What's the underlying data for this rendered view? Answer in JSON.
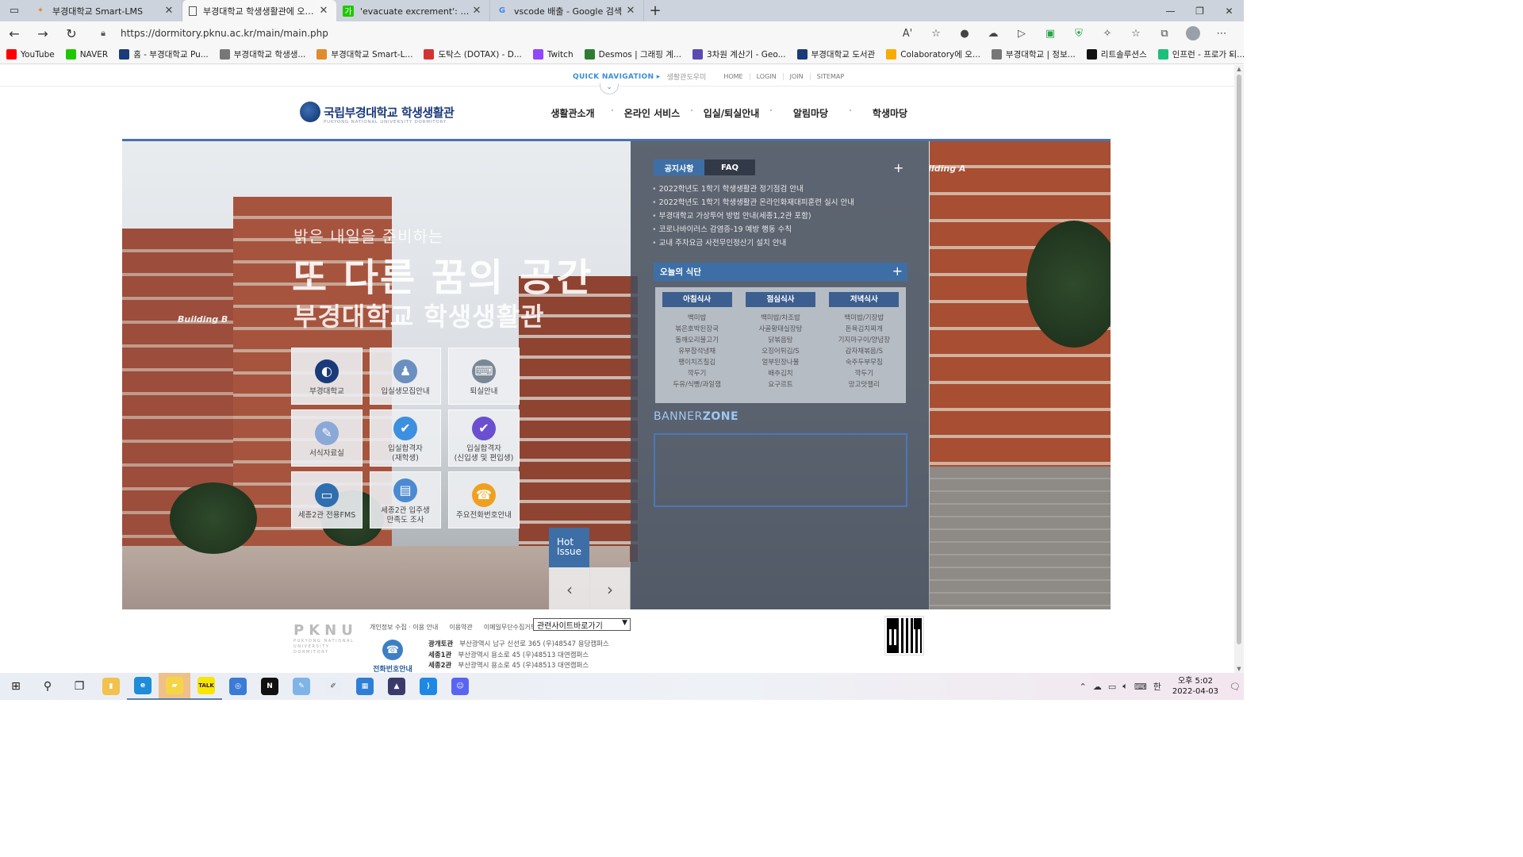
{
  "browser": {
    "tabs": [
      {
        "title": "부경대학교 Smart-LMS",
        "active": false,
        "favicon": "lms-icon",
        "color": "#e08b2c"
      },
      {
        "title": "부경대학교 학생생활관에 오신 것을",
        "active": true,
        "favicon": "page-icon",
        "color": "#555555"
      },
      {
        "title": "'evacuate excrement': 네이버 영어",
        "active": false,
        "favicon": "papago-icon",
        "color": "#1ec800"
      },
      {
        "title": "vscode 배출 - Google 검색",
        "active": false,
        "favicon": "google-icon",
        "color": "#4285f4"
      }
    ],
    "url": "https://dormitory.pknu.ac.kr/main/main.php",
    "bookmarks": [
      {
        "label": "YouTube",
        "color": "#ff0000"
      },
      {
        "label": "NAVER",
        "color": "#1ec800"
      },
      {
        "label": "홈 - 부경대학교 Pu...",
        "color": "#1b3a7a"
      },
      {
        "label": "부경대학교 학생생...",
        "color": "#777777"
      },
      {
        "label": "부경대학교 Smart-L...",
        "color": "#e08b2c"
      },
      {
        "label": "도탁스 (DOTAX) - D...",
        "color": "#d33333"
      },
      {
        "label": "Twitch",
        "color": "#9146ff"
      },
      {
        "label": "Desmos | 그래핑 계...",
        "color": "#2f7d32"
      },
      {
        "label": "3차원 계산기 - Geo...",
        "color": "#5a4ab2"
      },
      {
        "label": "부경대학교 도서관",
        "color": "#1b3a7a"
      },
      {
        "label": "Colaboratory에 오...",
        "color": "#f9ab00"
      },
      {
        "label": "부경대학교 | 정보...",
        "color": "#777777"
      },
      {
        "label": "리트솔루션스",
        "color": "#111111"
      },
      {
        "label": "인프런 - 프로가 되...",
        "color": "#1dc078"
      }
    ]
  },
  "site": {
    "quick_nav": "QUICK NAVIGATION",
    "quick_nav_sub": "생활관도우미",
    "top_links": [
      "HOME",
      "LOGIN",
      "JOIN",
      "SITEMAP"
    ],
    "logo_kr": "국립부경대학교 학생생활관",
    "logo_en": "PUKYONG NATIONAL UNIVERSITY DORMITORY",
    "gnb": [
      "생활관소개",
      "온라인 서비스",
      "입실/퇴실안내",
      "알림마당",
      "학생마당"
    ],
    "slogan": {
      "line1": "밝은 내일을 준비하는",
      "line2": "또 다른 꿈의 공간",
      "line3": "부경대학교 학생생활관"
    },
    "building_labels": [
      "Building B",
      "Building A"
    ],
    "quick_links": [
      {
        "label": "부경대학교",
        "icon": "pknu-logo-icon",
        "color": "#1b3a7a"
      },
      {
        "label": "입실생모집안내",
        "icon": "person-icon",
        "color": "#6a8fc0"
      },
      {
        "label": "퇴실안내",
        "icon": "keyboard-icon",
        "color": "#7a8796"
      },
      {
        "label": "서식자료실",
        "icon": "document-pen-icon",
        "color": "#8aa9d8"
      },
      {
        "label": "입실합격자\n(재학생)",
        "icon": "check-icon",
        "color": "#3d8fe0"
      },
      {
        "label": "입실합격자\n(신입생 및 편입생)",
        "icon": "check-icon",
        "color": "#6a4fd0"
      },
      {
        "label": "세종2관 전용FMS",
        "icon": "monitor-icon",
        "color": "#2f6fb0"
      },
      {
        "label": "세종2관 입주생\n만족도 조사",
        "icon": "cards-icon",
        "color": "#4c8ad0"
      },
      {
        "label": "주요전화번호안내",
        "icon": "telephone-icon",
        "color": "#f0a020"
      }
    ],
    "hot_issue": "Hot Issue",
    "notice_tabs": [
      "공지사항",
      "FAQ"
    ],
    "notices": [
      "2022학년도 1학기 학생생활관 정기점검 안내",
      "2022학년도 1학기 학생생활관 온라인화재대피훈련 실시 안내",
      "부경대학교 가상투어 방법 안내(세종1,2관 포함)",
      "코로나바이러스 감염증-19 예방 행동 수칙",
      "교내 주차요금 사전무인정산기 설치 안내"
    ],
    "meal_title": "오늘의 식단",
    "meals": [
      {
        "title": "아침식사",
        "items": [
          "백미밥",
          "볶은호박된장국",
          "돌깨오리불고기",
          "유부참석냉채",
          "팽이치즈칠김",
          "깍두기",
          "두유/식빵/과일잼"
        ]
      },
      {
        "title": "점심식사",
        "items": [
          "백미밥/차조밥",
          "사골황태실장탕",
          "닭볶음탕",
          "오징어튀김/S",
          "얼부된장나물",
          "배추김치",
          "요구르트"
        ]
      },
      {
        "title": "저녁식사",
        "items": [
          "백미밥/기장밥",
          "돈육김치찌개",
          "기지마구이/양념장",
          "감자채볶음/S",
          "숙주두부무침",
          "깍두기",
          "망고맛젤리"
        ]
      }
    ],
    "banner_zone_a": "BANNER",
    "banner_zone_b": "ZONE",
    "footer": {
      "logo_big": "PKNU",
      "logo_small": "PUKYONG NATIONAL UNIVERSITY DORMITORY",
      "links": [
        "개인정보 수집 · 이용 안내",
        "이용약관",
        "이메일무단수집거부"
      ],
      "family_site": "관련사이트바로가기",
      "phone_label": "전화번호안내",
      "addresses": [
        {
          "name": "광개토관",
          "addr": "부산광역시 남구 신선로 365 (우)48547 용당캠퍼스"
        },
        {
          "name": "세종1관",
          "addr": "부산광역시 용소로 45 (우)48513 대연캠퍼스"
        },
        {
          "name": "세종2관",
          "addr": "부산광역시 용소로 45 (우)48513 대연캠퍼스"
        }
      ]
    }
  },
  "taskbar": {
    "apps": [
      "file-explorer-icon",
      "edge-icon",
      "sticky-notes-icon",
      "kakaotalk-icon",
      "capture-icon",
      "notion-icon",
      "notepad-icon",
      "paint-icon",
      "calculator-icon",
      "cad-icon",
      "vscode-icon",
      "discord-icon"
    ],
    "ime": "한",
    "time": "오후 5:02",
    "date": "2022-04-03"
  }
}
